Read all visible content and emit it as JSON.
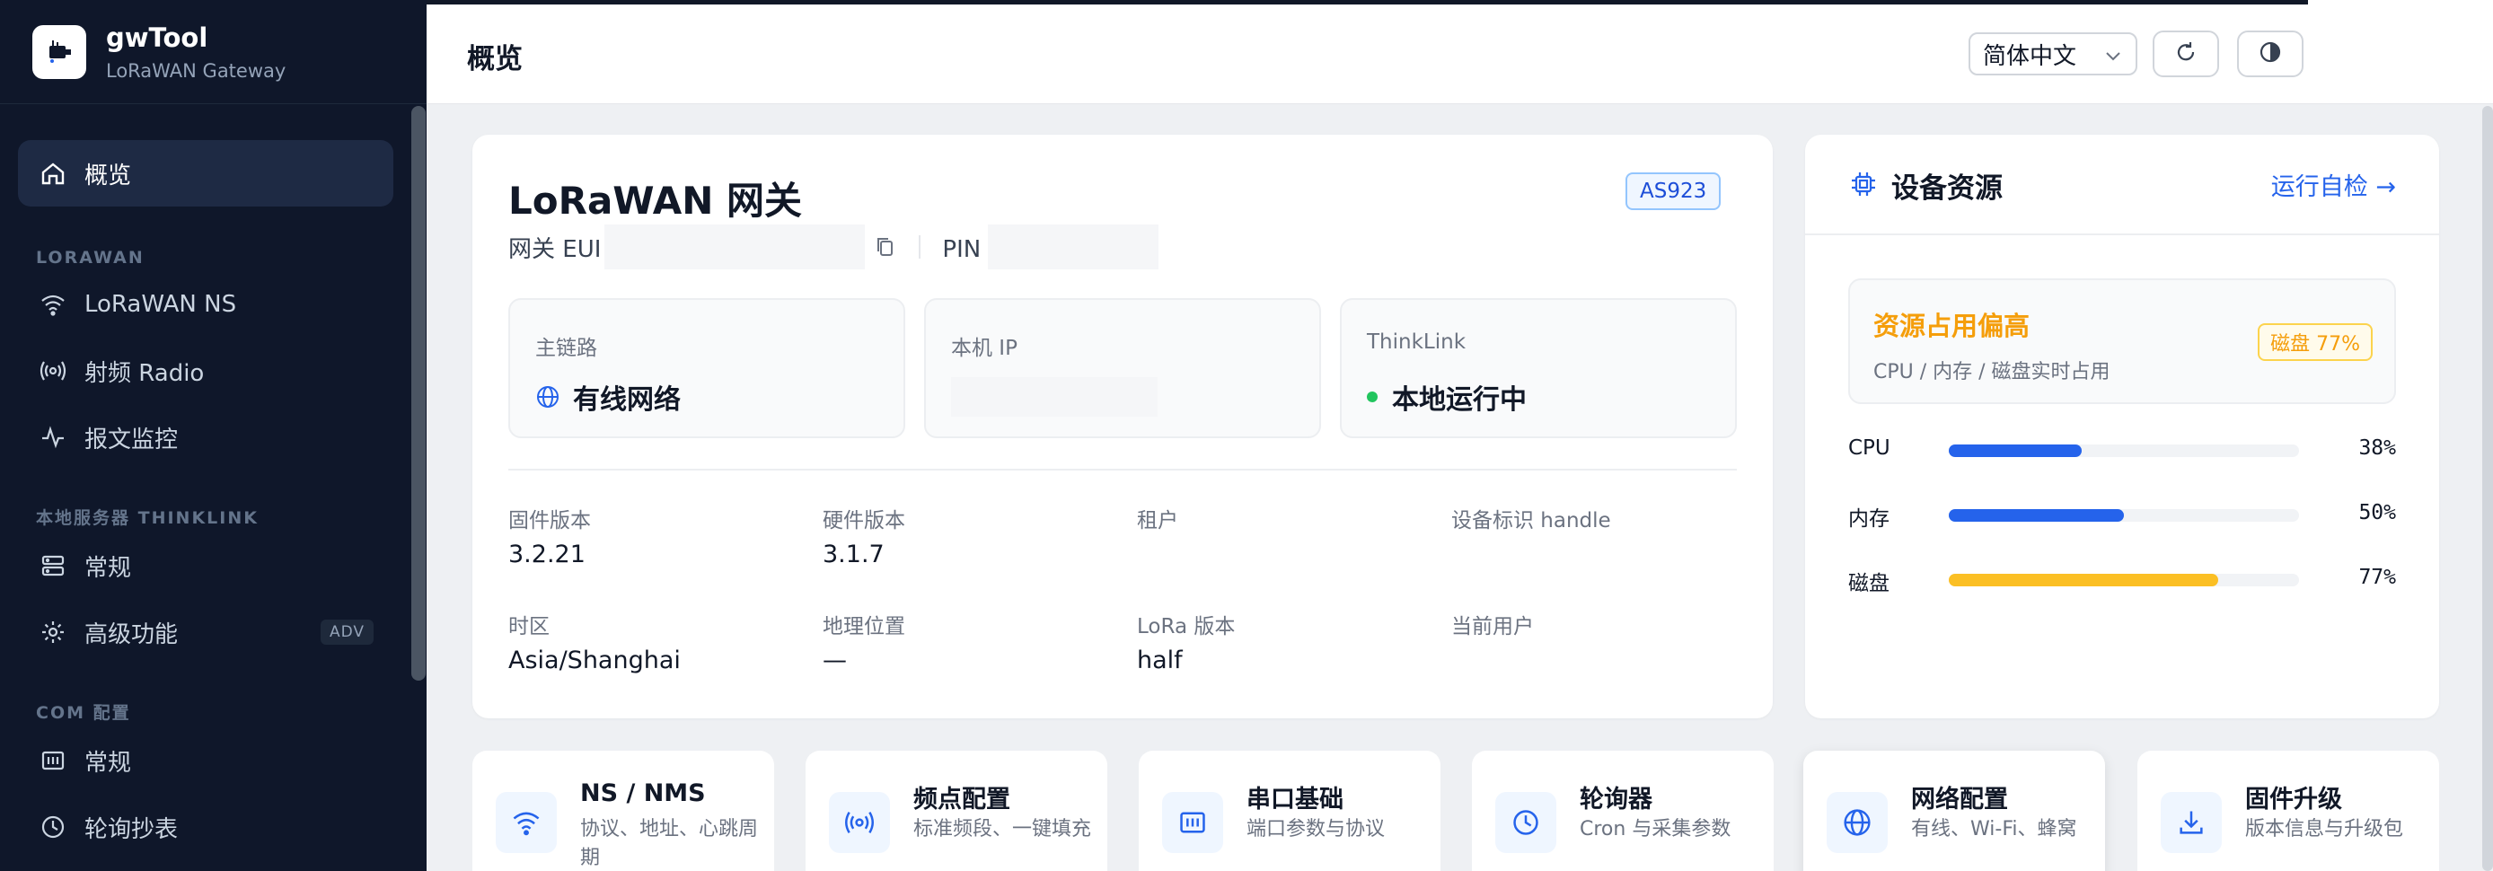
{
  "app": {
    "name": "gwTool",
    "subtitle": "LoRaWAN Gateway"
  },
  "sidebar": {
    "active": {
      "label": "概览",
      "icon": "home-icon"
    },
    "sections": [
      {
        "title": "LORAWAN",
        "items": [
          {
            "label": "LoRaWAN NS",
            "icon": "wifi-icon"
          },
          {
            "label": "射频 Radio",
            "icon": "radio-icon"
          },
          {
            "label": "报文监控",
            "icon": "activity-icon"
          }
        ]
      },
      {
        "title": "本地服务器 THINKLINK",
        "items": [
          {
            "label": "常规",
            "icon": "server-icon"
          },
          {
            "label": "高级功能",
            "icon": "gear-icon",
            "badge": "ADV"
          }
        ]
      },
      {
        "title": "COM 配置",
        "items": [
          {
            "label": "常规",
            "icon": "serial-icon"
          },
          {
            "label": "轮询抄表",
            "icon": "clock-icon"
          }
        ]
      }
    ]
  },
  "header": {
    "title": "概览",
    "language": "简体中文"
  },
  "gateway": {
    "title": "LoRaWAN 网关",
    "region": "AS923",
    "eui_label": "网关 EUI",
    "pin_label": "PIN 码",
    "stats": [
      {
        "label": "主链路",
        "value": "有线网络",
        "icon": "globe-icon"
      },
      {
        "label": "本机 IP",
        "value": ""
      },
      {
        "label": "ThinkLink",
        "value": "本地运行中",
        "status_color": "#22c55e"
      }
    ],
    "info": [
      {
        "label": "固件版本",
        "value": "3.2.21"
      },
      {
        "label": "硬件版本",
        "value": "3.1.7"
      },
      {
        "label": "租户",
        "value": ""
      },
      {
        "label": "设备标识 handle",
        "value": ""
      },
      {
        "label": "时区",
        "value": "Asia/Shanghai"
      },
      {
        "label": "地理位置",
        "value": "—"
      },
      {
        "label": "LoRa 版本",
        "value": "half"
      },
      {
        "label": "当前用户",
        "value": ""
      }
    ]
  },
  "resources": {
    "title": "设备资源",
    "self_check": "运行自检 →",
    "alert": {
      "title": "资源占用偏高",
      "subtitle": "CPU / 内存 / 磁盘实时占用",
      "badge": "磁盘 77%"
    },
    "bars": [
      {
        "label": "CPU",
        "value": 38,
        "pct": "38%",
        "color": "#2563eb"
      },
      {
        "label": "内存",
        "value": 50,
        "pct": "50%",
        "color": "#2563eb"
      },
      {
        "label": "磁盘",
        "value": 77,
        "pct": "77%",
        "color": "#fbbf24"
      }
    ]
  },
  "shortcuts": [
    {
      "title": "NS / NMS",
      "subtitle": "协议、地址、心跳周期",
      "icon": "wifi-icon"
    },
    {
      "title": "频点配置",
      "subtitle": "标准频段、一键填充",
      "icon": "radio-icon"
    },
    {
      "title": "串口基础",
      "subtitle": "端口参数与协议",
      "icon": "serial-icon"
    },
    {
      "title": "轮询器",
      "subtitle": "Cron 与采集参数",
      "icon": "clock-icon"
    },
    {
      "title": "网络配置",
      "subtitle": "有线、Wi-Fi、蜂窝",
      "icon": "globe-icon"
    },
    {
      "title": "固件升级",
      "subtitle": "版本信息与升级包",
      "icon": "download-icon"
    }
  ]
}
